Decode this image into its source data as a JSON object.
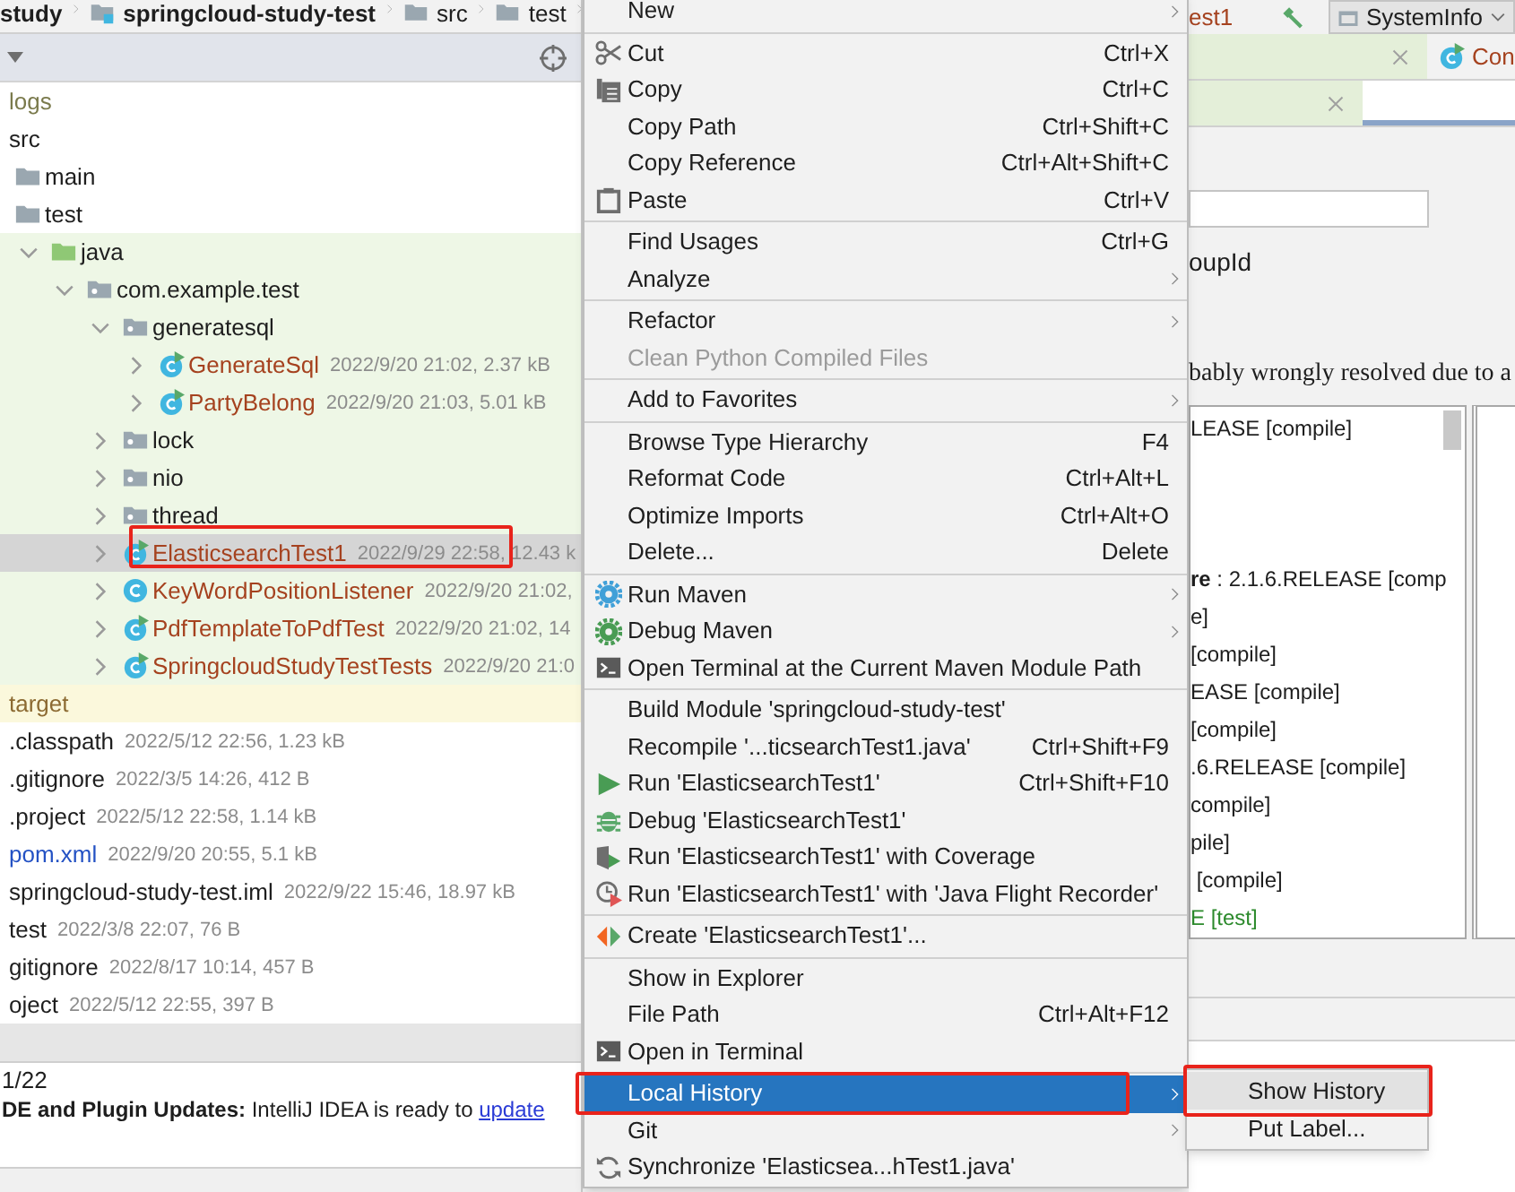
{
  "breadcrumb": [
    {
      "label": "study"
    },
    {
      "label": "springcloud-study-test"
    },
    {
      "label": "src"
    },
    {
      "label": "test"
    }
  ],
  "tree": [
    {
      "label": "logs",
      "kind": "folder",
      "color": "#7a7a4c",
      "selected": false
    },
    {
      "label": "src",
      "kind": "folder",
      "selected": false,
      "children": [
        {
          "label": "main",
          "kind": "folder",
          "selected": false
        },
        {
          "label": "test",
          "kind": "folder",
          "selected": false,
          "children": [
            {
              "label": "java",
              "kind": "test-root",
              "expanded": true,
              "selected": false,
              "children": [
                {
                  "label": "com.example.test",
                  "kind": "package",
                  "expanded": true,
                  "selected": false,
                  "children": [
                    {
                      "label": "generatesql",
                      "kind": "package",
                      "expanded": true,
                      "selected": false,
                      "children": [
                        {
                          "label": "GenerateSql",
                          "kind": "test-class",
                          "expanded": false,
                          "meta": "2022/9/20 21:02, 2.37 kB",
                          "color": "#a5421f",
                          "selected": false
                        },
                        {
                          "label": "PartyBelong",
                          "kind": "test-class",
                          "expanded": false,
                          "meta": "2022/9/20 21:03, 5.01 kB",
                          "color": "#a5421f",
                          "selected": false
                        }
                      ]
                    },
                    {
                      "label": "lock",
                      "kind": "package",
                      "expanded": false,
                      "selected": false
                    },
                    {
                      "label": "nio",
                      "kind": "package",
                      "expanded": false,
                      "selected": false
                    },
                    {
                      "label": "thread",
                      "kind": "package",
                      "expanded": false,
                      "selected": false
                    },
                    {
                      "label": "ElasticsearchTest1",
                      "kind": "test-class",
                      "expanded": false,
                      "meta": "2022/9/29 22:58, 12.43 k",
                      "color": "#a5421f",
                      "selected": true
                    },
                    {
                      "label": "KeyWordPositionListener",
                      "kind": "class",
                      "expanded": false,
                      "meta": "2022/9/20 21:02,",
                      "color": "#a5421f",
                      "selected": false
                    },
                    {
                      "label": "PdfTemplateToPdfTest",
                      "kind": "test-class",
                      "expanded": false,
                      "meta": "2022/9/20 21:02, 14",
                      "color": "#a5421f",
                      "selected": false
                    },
                    {
                      "label": "SpringcloudStudyTestTests",
                      "kind": "test-class",
                      "expanded": false,
                      "meta": "2022/9/20 21:0",
                      "color": "#a5421f",
                      "selected": false
                    }
                  ]
                }
              ]
            }
          ]
        }
      ]
    },
    {
      "label": "target",
      "kind": "excluded-folder",
      "color": "#8c6a32",
      "selected": false
    },
    {
      "label": ".classpath",
      "kind": "file",
      "meta": "2022/5/12 22:56, 1.23 kB",
      "selected": false
    },
    {
      "label": ".gitignore",
      "kind": "file",
      "meta": "2022/3/5 14:26, 412 B",
      "selected": false
    },
    {
      "label": ".project",
      "kind": "file",
      "meta": "2022/5/12 22:58, 1.14 kB",
      "selected": false
    },
    {
      "label": "pom.xml",
      "kind": "file",
      "meta": "2022/9/20 20:55, 5.1 kB",
      "color": "#2452c4",
      "selected": false
    },
    {
      "label": "springcloud-study-test.iml",
      "kind": "file",
      "meta": "2022/9/22 15:46, 18.97 kB",
      "selected": false
    },
    {
      "label": "test",
      "kind": "file",
      "meta": "2022/3/8 22:07, 76 B",
      "selected": false
    },
    {
      "label": "gitignore",
      "kind": "file",
      "meta": "2022/8/17 10:14, 457 B",
      "selected": false
    },
    {
      "label": "oject",
      "kind": "file",
      "meta": "2022/5/12 22:55, 397 B",
      "selected": false
    }
  ],
  "event_log": {
    "date": "1/22",
    "message": "**DE and Plugin Updates:** IntelliJ IDEA is ready to ",
    "link": "update"
  },
  "right_toolbar": {
    "tab_label": "est1",
    "config": "SystemInfo"
  },
  "tab_rows": [
    [
      {
        "closable": true,
        "selected": false
      },
      {
        "label": "Con",
        "selected": false
      }
    ],
    [
      {
        "closable": true,
        "selected": false
      },
      {
        "selected": true
      }
    ]
  ],
  "right_panel": {
    "label": "oupId",
    "warning": "bably wrongly resolved due to a",
    "lines": [
      {
        "text": "LEASE [compile]"
      },
      {
        "text": "**re** : 2.1.6.RELEASE [comp"
      },
      {
        "text": "e]"
      },
      {
        "text": "[compile]"
      },
      {
        "text": "EASE [compile]"
      },
      {
        "text": "[compile]"
      },
      {
        "text": ".6.RELEASE [compile]"
      },
      {
        "text": "compile]"
      },
      {
        "text": "pile]"
      },
      {
        "text": " [compile]"
      },
      {
        "text": "E [test]",
        "color": "#2c8a2c"
      }
    ]
  },
  "menu": [
    {
      "kind": "item",
      "label": "New",
      "submenu": true,
      "selected": false
    },
    {
      "kind": "separator"
    },
    {
      "kind": "item",
      "label": "Cut",
      "shortcut": "Ctrl+X",
      "selected": false
    },
    {
      "kind": "item",
      "label": "Copy",
      "shortcut": "Ctrl+C",
      "selected": false
    },
    {
      "kind": "item",
      "label": "Copy Path",
      "shortcut": "Ctrl+Shift+C",
      "selected": false
    },
    {
      "kind": "item",
      "label": "Copy Reference",
      "shortcut": "Ctrl+Alt+Shift+C",
      "selected": false
    },
    {
      "kind": "item",
      "label": "Paste",
      "shortcut": "Ctrl+V",
      "selected": false
    },
    {
      "kind": "separator"
    },
    {
      "kind": "item",
      "label": "Find Usages",
      "shortcut": "Ctrl+G",
      "selected": false
    },
    {
      "kind": "item",
      "label": "Analyze",
      "submenu": true,
      "selected": false
    },
    {
      "kind": "separator"
    },
    {
      "kind": "item",
      "label": "Refactor",
      "submenu": true,
      "selected": false
    },
    {
      "kind": "item",
      "label": "Clean Python Compiled Files",
      "disabled": true,
      "selected": false
    },
    {
      "kind": "separator"
    },
    {
      "kind": "item",
      "label": "Add to Favorites",
      "submenu": true,
      "selected": false
    },
    {
      "kind": "separator"
    },
    {
      "kind": "item",
      "label": "Browse Type Hierarchy",
      "shortcut": "F4",
      "selected": false
    },
    {
      "kind": "item",
      "label": "Reformat Code",
      "shortcut": "Ctrl+Alt+L",
      "selected": false
    },
    {
      "kind": "item",
      "label": "Optimize Imports",
      "shortcut": "Ctrl+Alt+O",
      "selected": false
    },
    {
      "kind": "item",
      "label": "Delete...",
      "shortcut": "Delete",
      "selected": false
    },
    {
      "kind": "separator"
    },
    {
      "kind": "item",
      "label": "Run Maven",
      "submenu": true,
      "selected": false
    },
    {
      "kind": "item",
      "label": "Debug Maven",
      "submenu": true,
      "selected": false
    },
    {
      "kind": "item",
      "label": "Open Terminal at the Current Maven Module Path",
      "selected": false
    },
    {
      "kind": "separator"
    },
    {
      "kind": "item",
      "label": "Build Module 'springcloud-study-test'",
      "selected": false
    },
    {
      "kind": "item",
      "label": "Recompile '...ticsearchTest1.java'",
      "shortcut": "Ctrl+Shift+F9",
      "selected": false
    },
    {
      "kind": "item",
      "label": "Run 'ElasticsearchTest1'",
      "shortcut": "Ctrl+Shift+F10",
      "selected": false
    },
    {
      "kind": "item",
      "label": "Debug 'ElasticsearchTest1'",
      "selected": false
    },
    {
      "kind": "item",
      "label": "Run 'ElasticsearchTest1' with Coverage",
      "selected": false
    },
    {
      "kind": "item",
      "label": "Run 'ElasticsearchTest1' with 'Java Flight Recorder'",
      "selected": false
    },
    {
      "kind": "separator"
    },
    {
      "kind": "item",
      "label": "Create 'ElasticsearchTest1'...",
      "selected": false
    },
    {
      "kind": "separator"
    },
    {
      "kind": "item",
      "label": "Show in Explorer",
      "selected": false
    },
    {
      "kind": "item",
      "label": "File Path",
      "shortcut": "Ctrl+Alt+F12",
      "selected": false
    },
    {
      "kind": "item",
      "label": "Open in Terminal",
      "selected": false
    },
    {
      "kind": "separator"
    },
    {
      "kind": "item",
      "label": "Local History",
      "submenu": true,
      "selected": true
    },
    {
      "kind": "item",
      "label": "Git",
      "submenu": true,
      "selected": false
    },
    {
      "kind": "item",
      "label": "Synchronize 'Elasticsea...hTest1.java'",
      "selected": false
    }
  ],
  "submenu": [
    {
      "label": "Show History",
      "selected": true
    },
    {
      "label": "Put Label...",
      "selected": false
    }
  ]
}
